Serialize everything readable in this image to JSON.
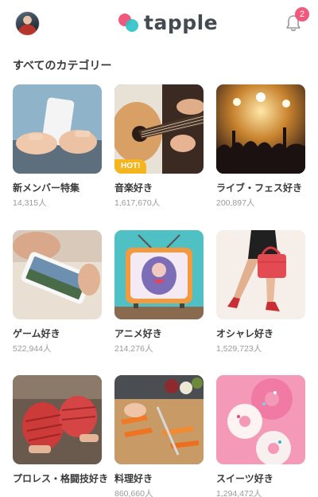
{
  "header": {
    "logo_text": "tapple",
    "notification_count": "2",
    "brand_colors": {
      "pink": "#f2577c",
      "teal": "#2fc2c7"
    }
  },
  "section": {
    "title": "すべてのカテゴリー"
  },
  "categories": [
    {
      "name": "新メンバー特集",
      "count": "14,315人",
      "icon": "smartphone-hands-photo"
    },
    {
      "name": "音楽好き",
      "count": "1,617,670人",
      "badge": "HOT!",
      "icon": "guitar-photo"
    },
    {
      "name": "ライブ・フェス好き",
      "count": "200,897人",
      "icon": "concert-crowd-photo"
    },
    {
      "name": "ゲーム好き",
      "count": "522,944人",
      "icon": "phone-game-photo"
    },
    {
      "name": "アニメ好き",
      "count": "214,276人",
      "icon": "retro-tv-photo"
    },
    {
      "name": "オシャレ好き",
      "count": "1,529,723人",
      "icon": "fashion-bag-photo"
    },
    {
      "name": "プロレス・格闘技好き",
      "count": "",
      "icon": "boxing-wraps-photo"
    },
    {
      "name": "料理好き",
      "count": "860,660人",
      "icon": "cooking-carrots-photo"
    },
    {
      "name": "スイーツ好き",
      "count": "1,294,472人",
      "icon": "donuts-photo"
    }
  ]
}
